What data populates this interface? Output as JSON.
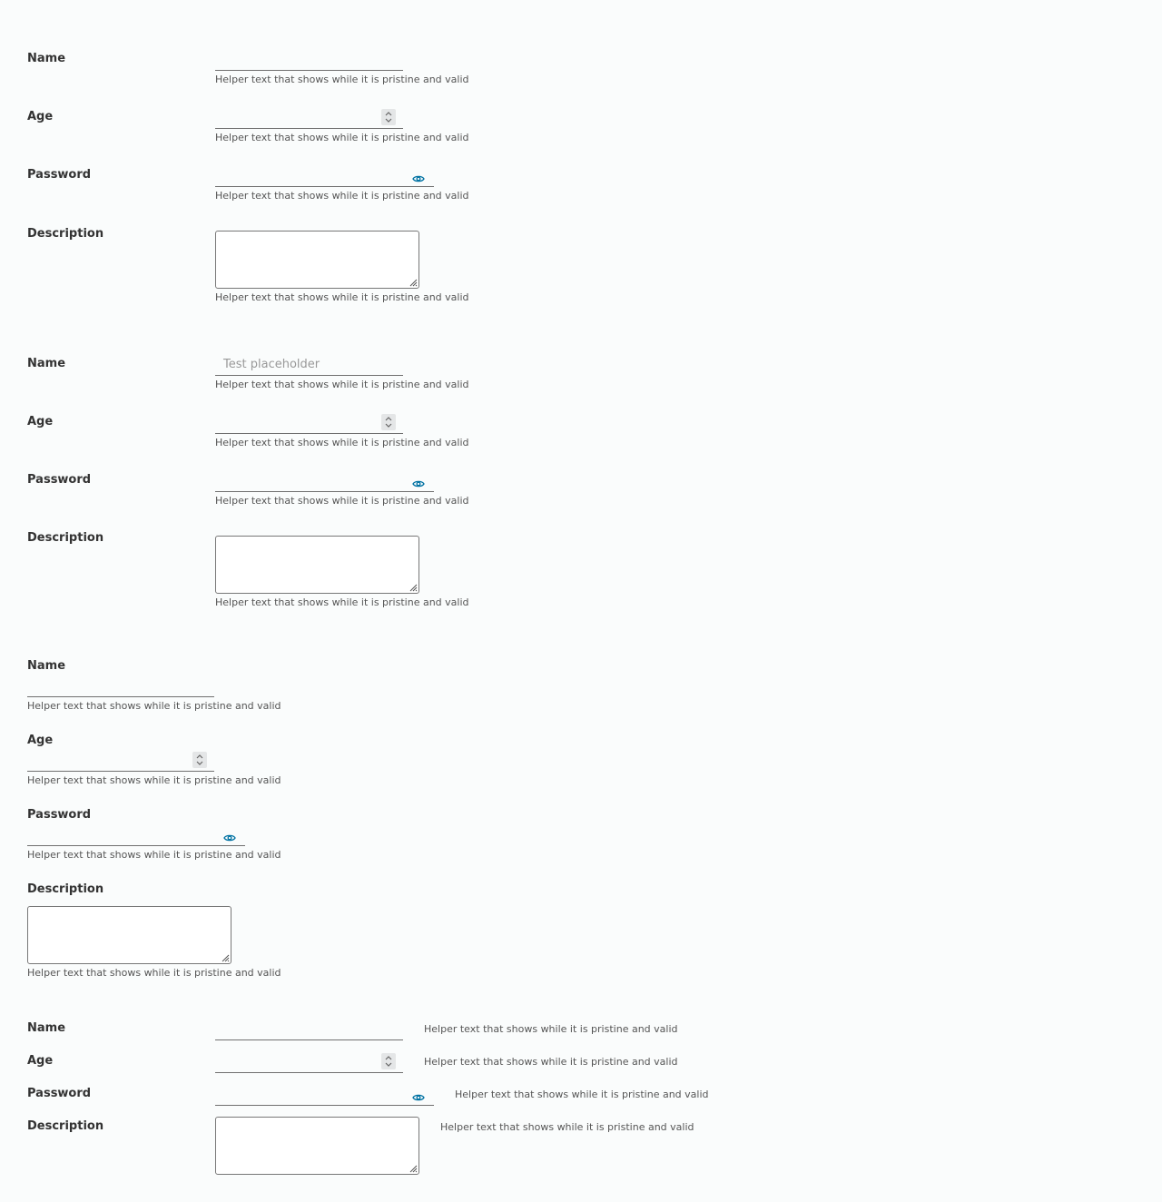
{
  "forms": [
    {
      "layout": "horizontal",
      "fields": [
        {
          "label": "Name",
          "helper": "Helper text that shows while it is pristine and valid",
          "placeholder": ""
        },
        {
          "label": "Age",
          "helper": "Helper text that shows while it is pristine and valid"
        },
        {
          "label": "Password",
          "helper": "Helper text that shows while it is pristine and valid"
        },
        {
          "label": "Description",
          "helper": "Helper text that shows while it is pristine and valid"
        }
      ]
    },
    {
      "layout": "horizontal",
      "fields": [
        {
          "label": "Name",
          "helper": "Helper text that shows while it is pristine and valid",
          "placeholder": "Test placeholder"
        },
        {
          "label": "Age",
          "helper": "Helper text that shows while it is pristine and valid"
        },
        {
          "label": "Password",
          "helper": "Helper text that shows while it is pristine and valid"
        },
        {
          "label": "Description",
          "helper": "Helper text that shows while it is pristine and valid"
        }
      ]
    },
    {
      "layout": "vertical",
      "fields": [
        {
          "label": "Name",
          "helper": "Helper text that shows while it is pristine and valid"
        },
        {
          "label": "Age",
          "helper": "Helper text that shows while it is pristine and valid"
        },
        {
          "label": "Password",
          "helper": "Helper text that shows while it is pristine and valid"
        },
        {
          "label": "Description",
          "helper": "Helper text that shows while it is pristine and valid"
        }
      ]
    },
    {
      "layout": "compact",
      "fields": [
        {
          "label": "Name",
          "helper": "Helper text that shows while it is pristine and valid"
        },
        {
          "label": "Age",
          "helper": "Helper text that shows while it is pristine and valid"
        },
        {
          "label": "Password",
          "helper": "Helper text that shows while it is pristine and valid"
        },
        {
          "label": "Description",
          "helper": "Helper text that shows while it is pristine and valid"
        }
      ]
    }
  ],
  "icons": {
    "password_toggle": "eye-icon",
    "number_spinner": "spinner-icon",
    "resize": "resize-grip-icon"
  },
  "colors": {
    "accent": "#0072a3",
    "border": "#6f6f6f",
    "background": "#fafcfc"
  }
}
